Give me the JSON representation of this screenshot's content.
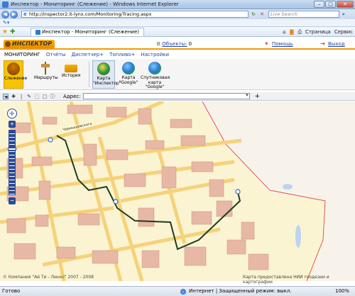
{
  "window": {
    "title": "Инспектор - Мониторинг (Слежение) - Windows Internet Explorer",
    "url": "http://inspector2.it-lynx.com/Monitoring/Tracing.aspx",
    "search_placeholder": "Live Search",
    "tab_title": "Инспектор - Мониторинг (Слежение)",
    "tools": [
      "Страница",
      "Сервис"
    ]
  },
  "app": {
    "logo": "ИНСПЕКТОР",
    "objects_label": "Объекты:",
    "objects_count": "0",
    "help": "Помощь",
    "logout": "Выход",
    "menu": [
      "МОНИТОРИНГ",
      "Отчёты",
      "Диспетчер+",
      "Топливо+",
      "Настройки"
    ],
    "ribbon": [
      {
        "label": "Слежение",
        "icon": "tracking-icon"
      },
      {
        "label": "Маршруты",
        "icon": "routes-icon"
      },
      {
        "label": "История",
        "icon": "history-truck-icon"
      },
      {
        "label": "Карта \"Инспектор\"",
        "icon": "map-inspector-icon"
      },
      {
        "label": "Карта \"Google\"",
        "icon": "google-globe-icon"
      },
      {
        "label": "Спутниковая карта \"Google\"",
        "icon": "satellite-globe-icon"
      }
    ]
  },
  "map": {
    "address_label": "Адрес:",
    "street_label": "Чернышевского",
    "copyright": "© Компания \"Ай Ти - Линкс\" 2007 - 2008",
    "source": "Карта предоставлена НИИ геодезии и картографии"
  },
  "status": {
    "left": "Готово",
    "zone": "Интернет | Защищенный режим: выкл.",
    "zoom": "100%"
  },
  "colors": {
    "accent": "#f29a00",
    "route": "#1f3d1f",
    "map_background": "#fbf4d2"
  }
}
